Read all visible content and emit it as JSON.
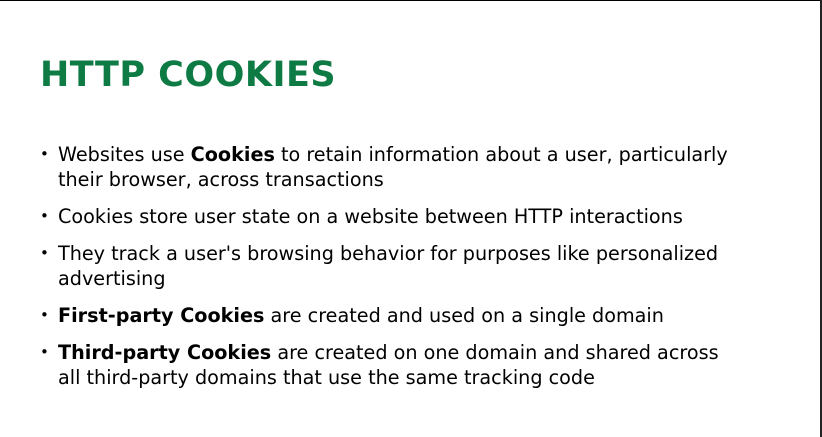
{
  "slide": {
    "title": "HTTP COOKIES",
    "title_color": "#0e7a44",
    "bullet_glyph": "•",
    "bullets": [
      {
        "line1_pre": "Websites use ",
        "line1_bold": "Cookies",
        "line1_post": " to retain information about a user, particularly",
        "line2": "their browser, across transactions"
      },
      {
        "line1": "Cookies store user state on a website between HTTP interactions"
      },
      {
        "line1": "They track a user's browsing behavior for purposes like personalized",
        "line2": "advertising"
      },
      {
        "line1_bold": "First-party Cookies",
        "line1_post": " are created and used on a single domain"
      },
      {
        "line1_bold": "Third-party Cookies",
        "line1_post": " are created on one domain and shared across",
        "line2": "all third-party domains that use the same tracking code"
      }
    ]
  }
}
